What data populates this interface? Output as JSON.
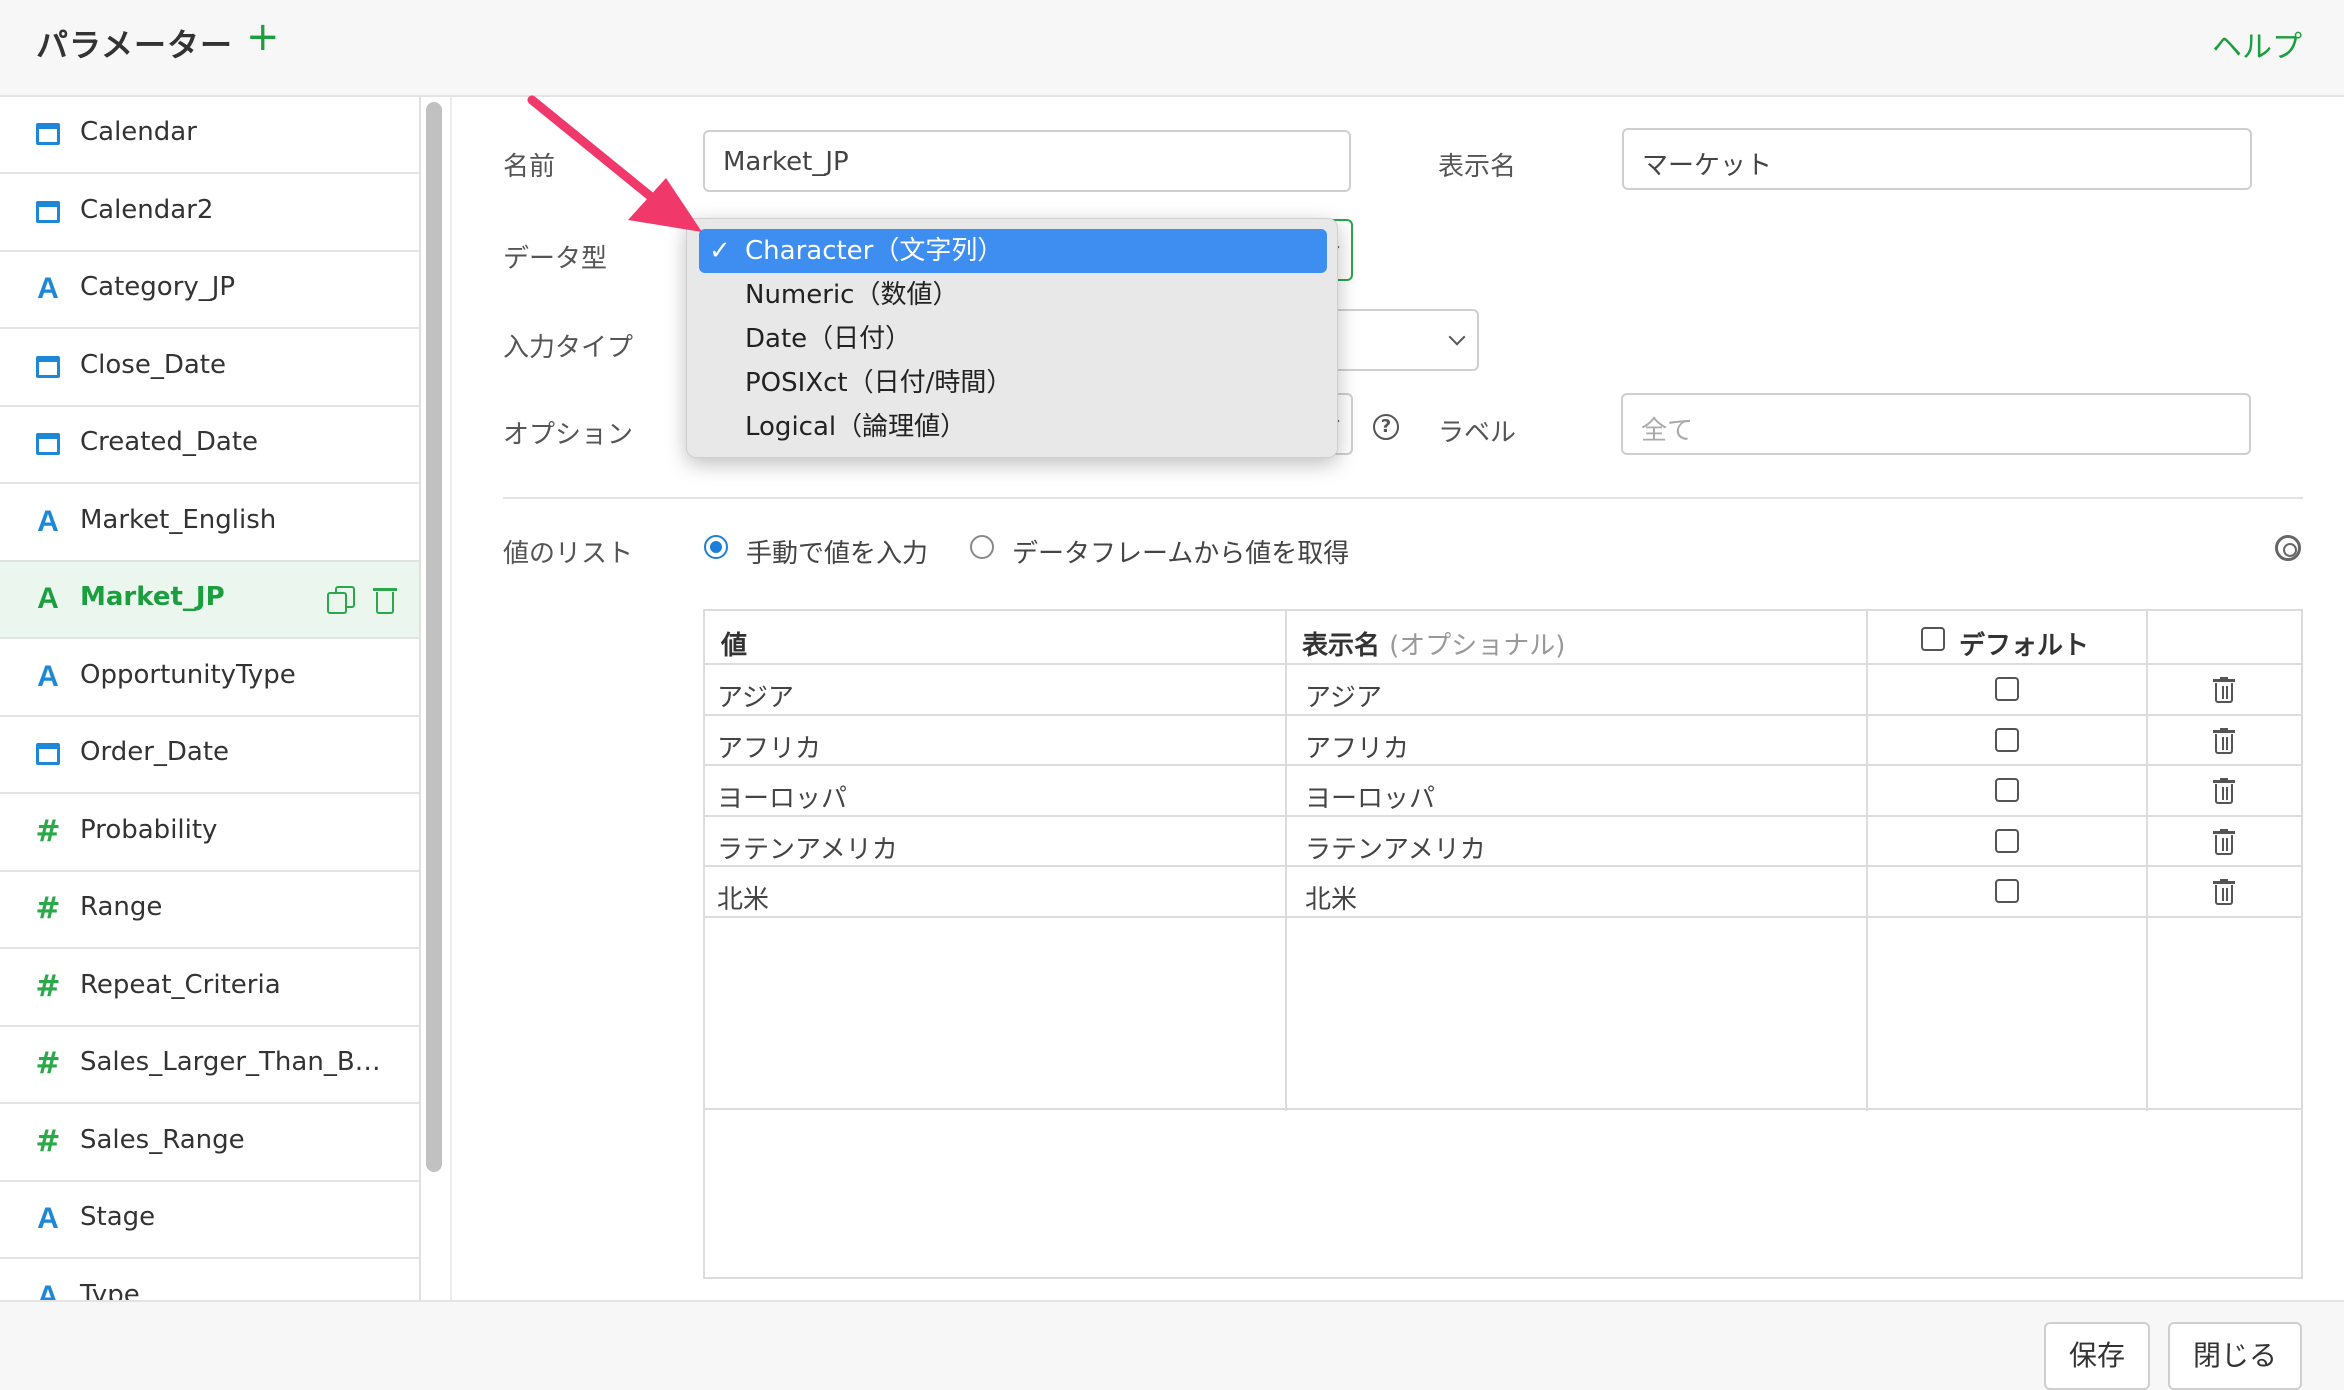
{
  "header": {
    "title": "パラメーター",
    "add_label": "+",
    "help": "ヘルプ"
  },
  "sidebar": {
    "items": [
      {
        "label": "Calendar",
        "type": "calendar"
      },
      {
        "label": "Calendar2",
        "type": "calendar"
      },
      {
        "label": "Category_JP",
        "type": "text"
      },
      {
        "label": "Close_Date",
        "type": "calendar"
      },
      {
        "label": "Created_Date",
        "type": "calendar"
      },
      {
        "label": "Market_English",
        "type": "text"
      },
      {
        "label": "Market_JP",
        "type": "text",
        "active": true
      },
      {
        "label": "OpportunityType",
        "type": "text"
      },
      {
        "label": "Order_Date",
        "type": "calendar"
      },
      {
        "label": "Probability",
        "type": "number"
      },
      {
        "label": "Range",
        "type": "number"
      },
      {
        "label": "Repeat_Criteria",
        "type": "number"
      },
      {
        "label": "Sales_Larger_Than_B…",
        "type": "number"
      },
      {
        "label": "Sales_Range",
        "type": "number"
      },
      {
        "label": "Stage",
        "type": "text"
      },
      {
        "label": "Type",
        "type": "text"
      }
    ],
    "icon_glyphs": {
      "text": "A",
      "number": "#"
    }
  },
  "form": {
    "name_label": "名前",
    "name_value": "Market_JP",
    "display_label": "表示名",
    "display_value": "マーケット",
    "datatype_label": "データ型",
    "inputtype_label": "入力タイプ",
    "option_label": "オプション",
    "label_label": "ラベル",
    "label_placeholder": "全て",
    "help_glyph": "?"
  },
  "datatype_dropdown": {
    "check": "✓",
    "options": [
      {
        "label": "Character（文字列）",
        "selected": true
      },
      {
        "label": "Numeric（数値）"
      },
      {
        "label": "Date（日付）"
      },
      {
        "label": "POSIXct（日付/時間）"
      },
      {
        "label": "Logical（論理値）"
      }
    ]
  },
  "values": {
    "list_label": "値のリスト",
    "radio_manual": "手動で値を入力",
    "radio_dataframe": "データフレームから値を取得",
    "table": {
      "col_value": "値",
      "col_display": "表示名",
      "col_display_optional": "(オプショナル)",
      "col_default": "デフォルト",
      "rows": [
        {
          "value": "アジア",
          "display": "アジア"
        },
        {
          "value": "アフリカ",
          "display": "アフリカ"
        },
        {
          "value": "ヨーロッパ",
          "display": "ヨーロッパ"
        },
        {
          "value": "ラテンアメリカ",
          "display": "ラテンアメリカ"
        },
        {
          "value": "北米",
          "display": "北米"
        }
      ]
    }
  },
  "footer": {
    "save": "保存",
    "close": "閉じる"
  },
  "colors": {
    "accent_green": "#1a9e3e",
    "accent_blue": "#1e88d8",
    "selection_blue": "#3d8ef0",
    "arrow_pink": "#f0386b"
  }
}
